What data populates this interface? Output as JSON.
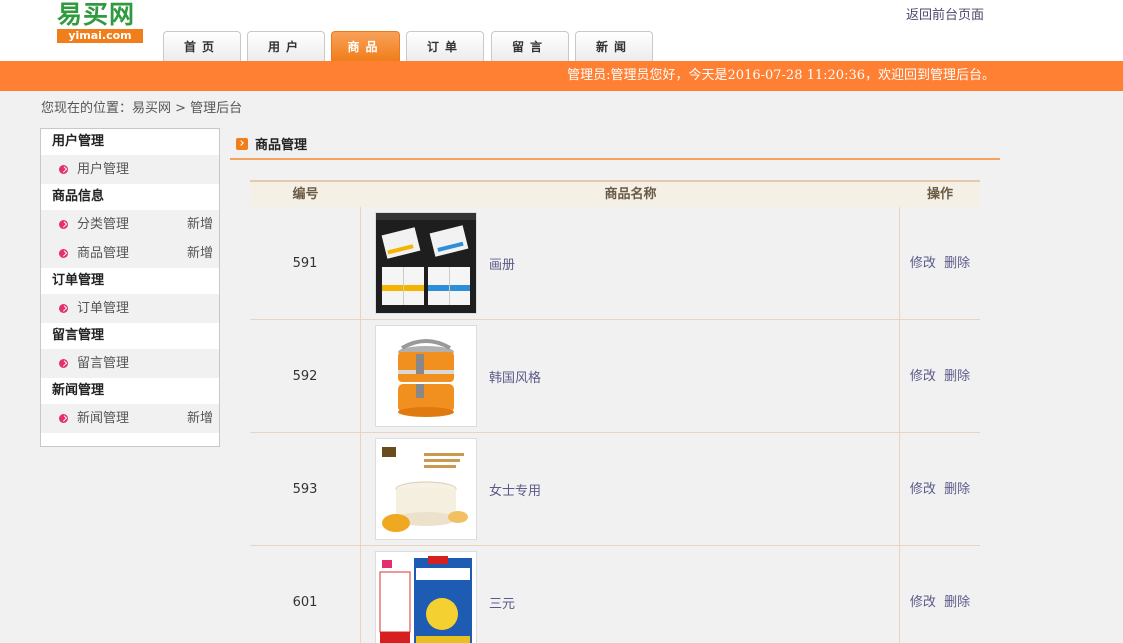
{
  "header": {
    "logo_cn": "易买网",
    "logo_en": "yimai.com",
    "back_link": "返回前台页面",
    "nav": [
      "首页",
      "用户",
      "商品",
      "订单",
      "留言",
      "新闻"
    ],
    "active_nav": "商品"
  },
  "topbar": {
    "welcome": "管理员:管理员您好，今天是2016-07-28 11:20:36，欢迎回到管理后台。"
  },
  "breadcrumb": "您现在的位置：易买网 > 管理后台",
  "sidebar": {
    "sections": [
      {
        "title": "用户管理",
        "items": [
          {
            "label": "用户管理",
            "add": ""
          }
        ]
      },
      {
        "title": "商品信息",
        "items": [
          {
            "label": "分类管理",
            "add": "新增"
          },
          {
            "label": "商品管理",
            "add": "新增"
          }
        ]
      },
      {
        "title": "订单管理",
        "items": [
          {
            "label": "订单管理",
            "add": ""
          }
        ]
      },
      {
        "title": "留言管理",
        "items": [
          {
            "label": "留言管理",
            "add": ""
          }
        ]
      },
      {
        "title": "新闻管理",
        "items": [
          {
            "label": "新闻管理",
            "add": "新增"
          }
        ]
      }
    ]
  },
  "main": {
    "title": "商品管理",
    "columns": {
      "id": "编号",
      "name": "商品名称",
      "op": "操作"
    },
    "edit_label": "修改",
    "delete_label": "删除",
    "rows": [
      {
        "id": "591",
        "name": "画册",
        "image": "brochure"
      },
      {
        "id": "592",
        "name": "韩国风格",
        "image": "lunchbox"
      },
      {
        "id": "593",
        "name": "女士专用",
        "image": "cream-jar"
      },
      {
        "id": "601",
        "name": "三元",
        "image": "milk-powder-can"
      }
    ]
  },
  "colors": {
    "accent": "#ff7f33",
    "logo_green": "#2f9a3e",
    "bullet": "#e3306e",
    "link": "#5a5a8a"
  }
}
